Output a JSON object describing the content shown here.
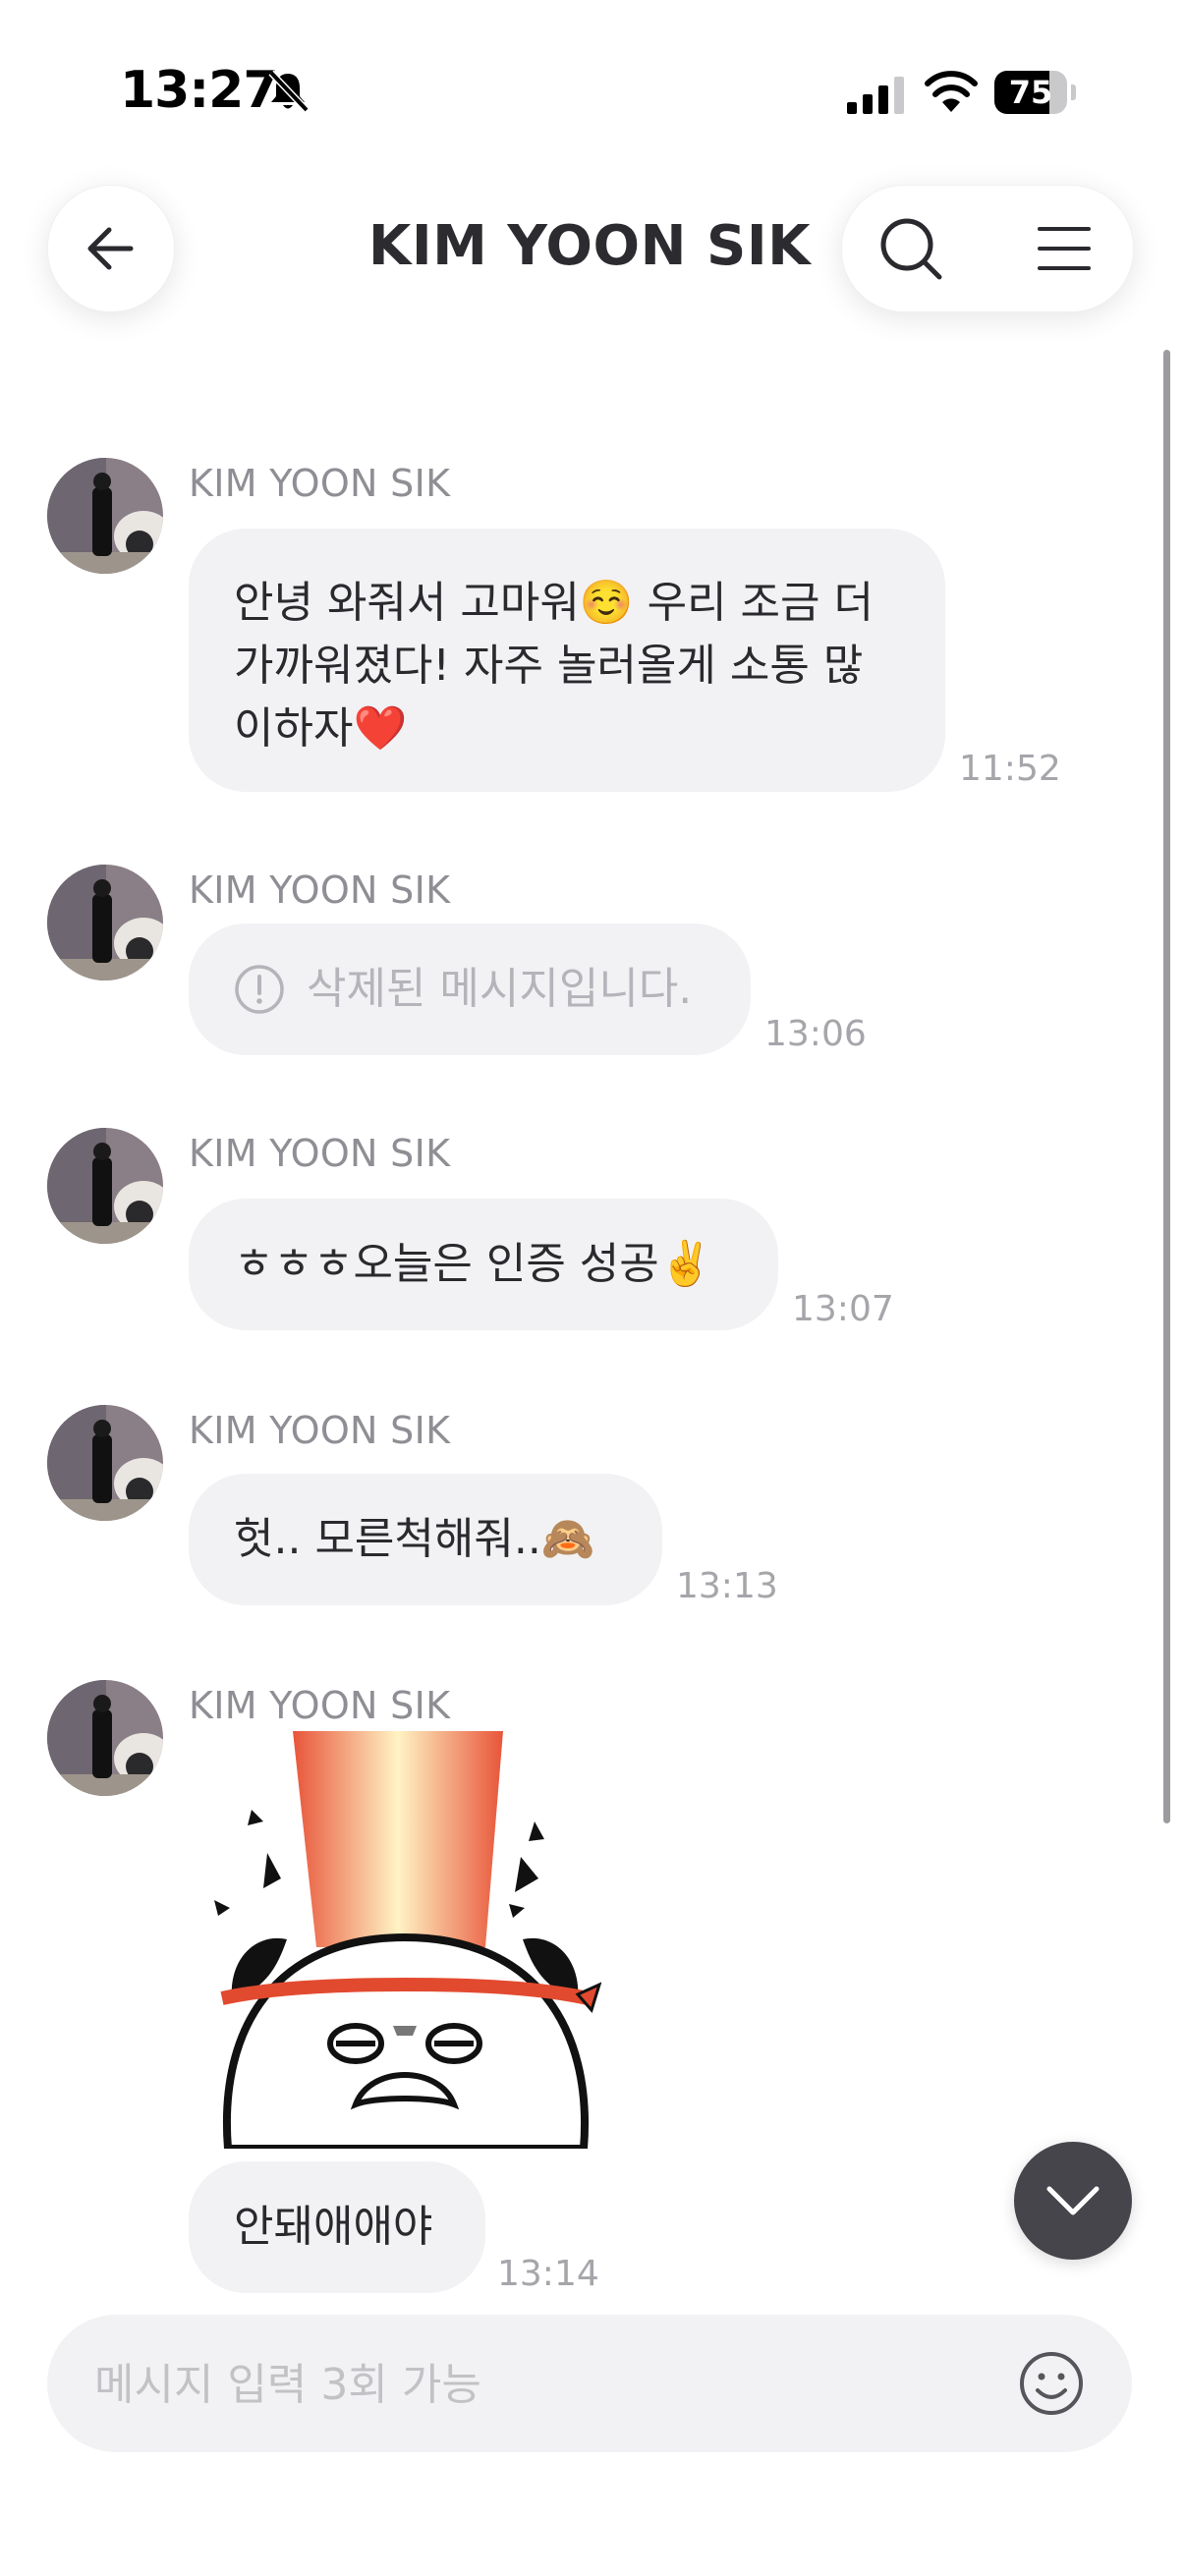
{
  "status_bar": {
    "time": "13:27",
    "battery": "75",
    "battery_level": 0.75
  },
  "header": {
    "title": "KIM YOON SIK"
  },
  "messages": [
    {
      "sender": "KIM YOON SIK",
      "lines": [
        "안녕 와줘서 고마워☺️ 우리 조금 더",
        "가까워졌다! 자주 놀러올게 소통 많",
        "이하자❤️"
      ],
      "time": "11:52"
    },
    {
      "sender": "KIM YOON SIK",
      "text": "삭제된 메시지입니다.",
      "time": "13:06"
    },
    {
      "sender": "KIM YOON SIK",
      "text": "ㅎㅎㅎ오늘은 인증 성공✌️",
      "time": "13:07"
    },
    {
      "sender": "KIM YOON SIK",
      "text": "헛.. 모른척해줘..🙈",
      "time": "13:13"
    },
    {
      "sender": "KIM YOON SIK",
      "text": "안돼애애야",
      "time": "13:14"
    }
  ],
  "input": {
    "placeholder": "메시지 입력 3회 가능",
    "value": ""
  },
  "icons": {
    "back": "arrow-left-icon",
    "search": "search-icon",
    "menu": "menu-icon",
    "deleted": "alert-circle-icon",
    "scroll_down": "chevron-down-icon",
    "emoji": "smiley-icon",
    "mute": "bell-slash-icon"
  },
  "colors": {
    "bubble": "#f2f2f4",
    "sender": "#8e8e94",
    "timestamp": "#a5a5aa",
    "fab": "#45454b"
  }
}
